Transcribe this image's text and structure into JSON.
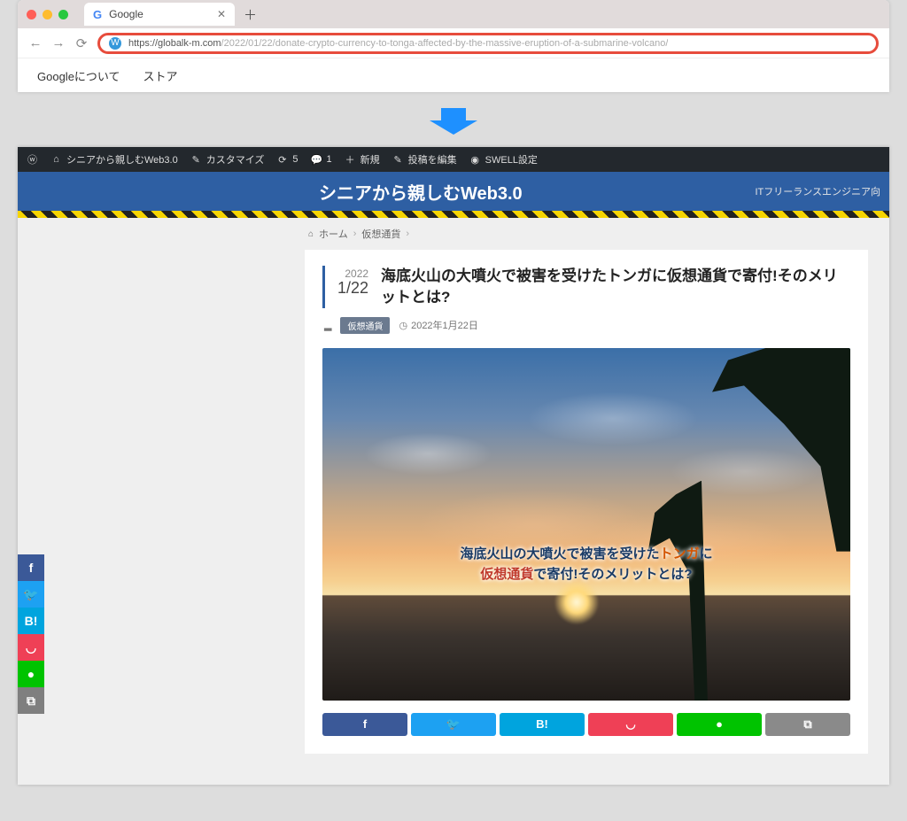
{
  "browser": {
    "tab_title": "Google",
    "url_dark": "https://globalk-m.com",
    "url_light": "/2022/01/22/donate-crypto-currency-to-tonga-affected-by-the-massive-eruption-of-a-submarine-volcano/",
    "menu": {
      "about": "Googleについて",
      "store": "ストア"
    }
  },
  "adminbar": {
    "site": "シニアから親しむWeb3.0",
    "customize": "カスタマイズ",
    "updates": "5",
    "comments": "1",
    "new": "新規",
    "edit": "投稿を編集",
    "swell": "SWELL設定"
  },
  "header": {
    "title": "シニアから親しむWeb3.0",
    "tagline": "ITフリーランスエンジニア向"
  },
  "breadcrumb": {
    "home": "ホーム",
    "cat": "仮想通貨"
  },
  "post": {
    "year": "2022",
    "monthday": "1/22",
    "title": "海底火山の大噴火で被害を受けたトンガに仮想通貨で寄付!そのメリットとは?",
    "category": "仮想通貨",
    "date": "2022年1月22日",
    "hero": {
      "line1_a": "海底火山の大噴火で被害を受けた",
      "line1_b": "トンガ",
      "line1_c": "に",
      "line2_a": "仮想通貨",
      "line2_b": "で寄付!そのメリットとは?"
    }
  },
  "share": {
    "fb": "f",
    "tw": "🐦",
    "hb": "B!",
    "pk": "◡",
    "ln": "●",
    "cp": "⧉"
  }
}
